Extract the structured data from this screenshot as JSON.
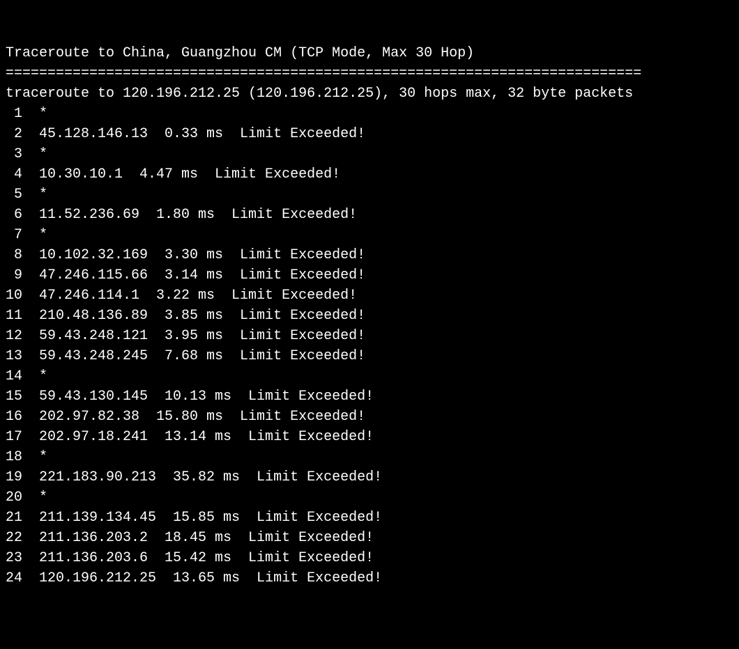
{
  "title": "Traceroute to China, Guangzhou CM (TCP Mode, Max 30 Hop)",
  "separator": "============================================================================",
  "header": "traceroute to 120.196.212.25 (120.196.212.25), 30 hops max, 32 byte packets",
  "note": "Limit Exceeded!",
  "hops": [
    {
      "n": "1",
      "timeout": true
    },
    {
      "n": "2",
      "ip": "45.128.146.13",
      "rtt": "0.33 ms"
    },
    {
      "n": "3",
      "timeout": true
    },
    {
      "n": "4",
      "ip": "10.30.10.1",
      "rtt": "4.47 ms"
    },
    {
      "n": "5",
      "timeout": true
    },
    {
      "n": "6",
      "ip": "11.52.236.69",
      "rtt": "1.80 ms"
    },
    {
      "n": "7",
      "timeout": true
    },
    {
      "n": "8",
      "ip": "10.102.32.169",
      "rtt": "3.30 ms"
    },
    {
      "n": "9",
      "ip": "47.246.115.66",
      "rtt": "3.14 ms"
    },
    {
      "n": "10",
      "ip": "47.246.114.1",
      "rtt": "3.22 ms"
    },
    {
      "n": "11",
      "ip": "210.48.136.89",
      "rtt": "3.85 ms"
    },
    {
      "n": "12",
      "ip": "59.43.248.121",
      "rtt": "3.95 ms"
    },
    {
      "n": "13",
      "ip": "59.43.248.245",
      "rtt": "7.68 ms"
    },
    {
      "n": "14",
      "timeout": true
    },
    {
      "n": "15",
      "ip": "59.43.130.145",
      "rtt": "10.13 ms"
    },
    {
      "n": "16",
      "ip": "202.97.82.38",
      "rtt": "15.80 ms"
    },
    {
      "n": "17",
      "ip": "202.97.18.241",
      "rtt": "13.14 ms"
    },
    {
      "n": "18",
      "timeout": true
    },
    {
      "n": "19",
      "ip": "221.183.90.213",
      "rtt": "35.82 ms"
    },
    {
      "n": "20",
      "timeout": true
    },
    {
      "n": "21",
      "ip": "211.139.134.45",
      "rtt": "15.85 ms"
    },
    {
      "n": "22",
      "ip": "211.136.203.2",
      "rtt": "18.45 ms"
    },
    {
      "n": "23",
      "ip": "211.136.203.6",
      "rtt": "15.42 ms"
    },
    {
      "n": "24",
      "ip": "120.196.212.25",
      "rtt": "13.65 ms"
    }
  ]
}
